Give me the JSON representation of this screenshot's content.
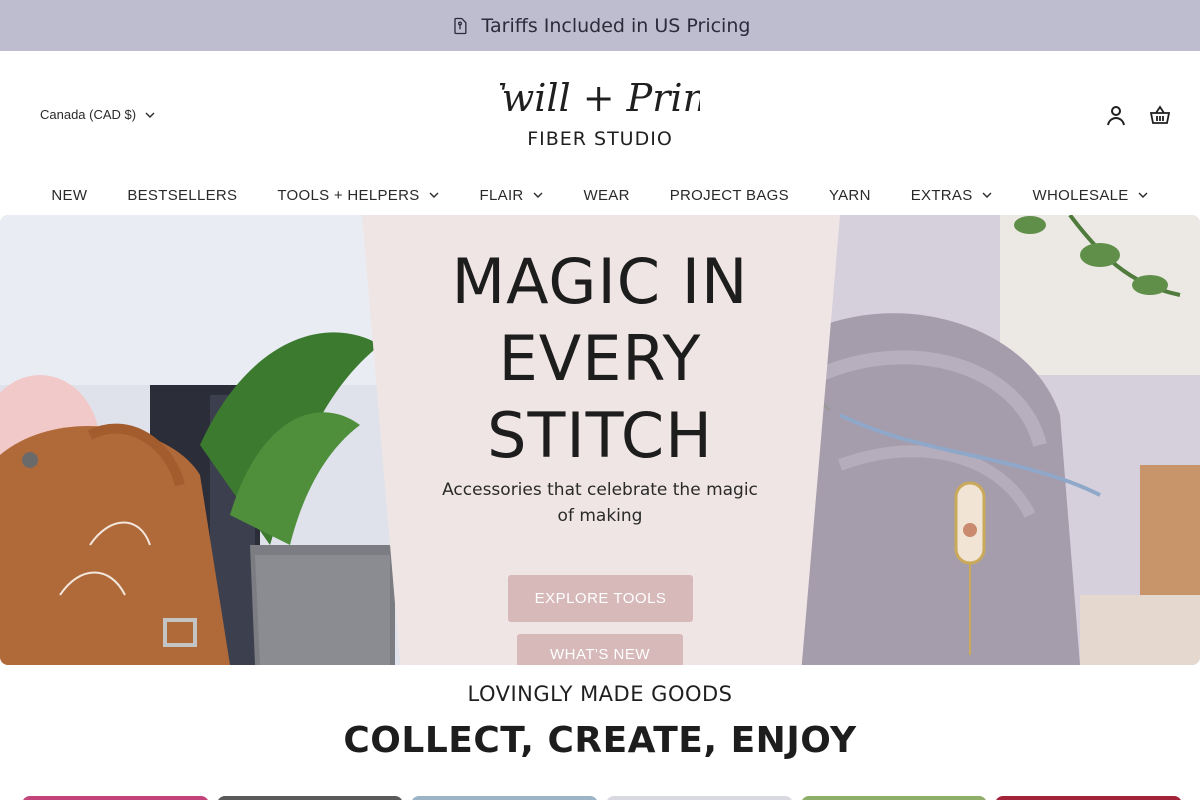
{
  "announcement": {
    "text": "Tariffs Included in US Pricing",
    "icon": "tag-icon"
  },
  "header": {
    "country": "Canada (CAD $)",
    "logo": {
      "line1": "Twill + Print",
      "line2": "FIBER STUDIO"
    },
    "icons": [
      "account-icon",
      "basket-icon"
    ]
  },
  "nav": {
    "items": [
      {
        "label": "NEW",
        "dropdown": false
      },
      {
        "label": "BESTSELLERS",
        "dropdown": false
      },
      {
        "label": "TOOLS + HELPERS",
        "dropdown": true
      },
      {
        "label": "FLAIR",
        "dropdown": true
      },
      {
        "label": "WEAR",
        "dropdown": false
      },
      {
        "label": "PROJECT BAGS",
        "dropdown": false
      },
      {
        "label": "YARN",
        "dropdown": false
      },
      {
        "label": "EXTRAS",
        "dropdown": true
      },
      {
        "label": "WHOLESALE",
        "dropdown": true
      }
    ]
  },
  "hero": {
    "title_lines": [
      "MAGIC IN",
      "EVERY",
      "STITCH"
    ],
    "subtitle": "Accessories that celebrate the magic of making",
    "primary_button": "EXPLORE TOOLS",
    "secondary_button": "WHAT'S NEW"
  },
  "section": {
    "eyebrow": "LOVINGLY MADE GOODS",
    "title": "COLLECT, CREATE, ENJOY"
  },
  "colors": {
    "announcement_bg": "#bdbdcf",
    "hero_panel_bg": "#efe5e4",
    "button_bg": "#d6b9b8"
  }
}
